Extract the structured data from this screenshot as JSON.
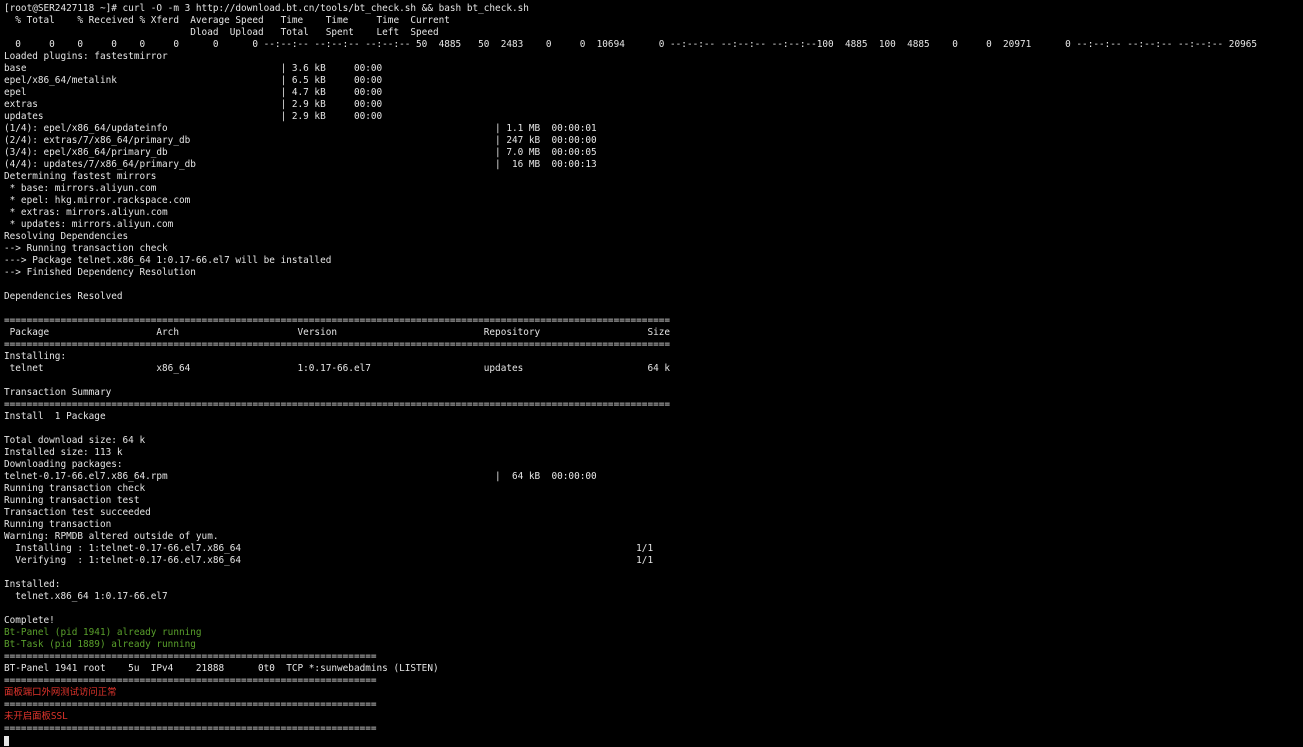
{
  "terminal": {
    "colors": {
      "background": "#000000",
      "foreground": "#e6e6e6",
      "green": "#5aa02c",
      "red": "#e0342c"
    },
    "lines": [
      {
        "text": "[root@SER2427118 ~]# curl -O -m 3 http://download.bt.cn/tools/bt_check.sh && bash bt_check.sh",
        "color": "default"
      },
      {
        "text": "  % Total    % Received % Xferd  Average Speed   Time    Time     Time  Current",
        "color": "default"
      },
      {
        "text": "                                 Dload  Upload   Total   Spent    Left  Speed",
        "color": "default"
      },
      {
        "text": "  0     0    0     0    0     0      0      0 --:--:-- --:--:-- --:--:-- 50  4885   50  2483    0     0  10694      0 --:--:-- --:--:-- --:--:--100  4885  100  4885    0     0  20971      0 --:--:-- --:--:-- --:--:-- 20965",
        "color": "default"
      },
      {
        "text": "Loaded plugins: fastestmirror",
        "color": "default"
      },
      {
        "text": "base                                             | 3.6 kB     00:00",
        "color": "default"
      },
      {
        "text": "epel/x86_64/metalink                             | 6.5 kB     00:00",
        "color": "default"
      },
      {
        "text": "epel                                             | 4.7 kB     00:00",
        "color": "default"
      },
      {
        "text": "extras                                           | 2.9 kB     00:00",
        "color": "default"
      },
      {
        "text": "updates                                          | 2.9 kB     00:00",
        "color": "default"
      },
      {
        "text": "(1/4): epel/x86_64/updateinfo                                                          | 1.1 MB  00:00:01",
        "color": "default"
      },
      {
        "text": "(2/4): extras/7/x86_64/primary_db                                                      | 247 kB  00:00:00",
        "color": "default"
      },
      {
        "text": "(3/4): epel/x86_64/primary_db                                                          | 7.0 MB  00:00:05",
        "color": "default"
      },
      {
        "text": "(4/4): updates/7/x86_64/primary_db                                                     |  16 MB  00:00:13",
        "color": "default"
      },
      {
        "text": "Determining fastest mirrors",
        "color": "default"
      },
      {
        "text": " * base: mirrors.aliyun.com",
        "color": "default"
      },
      {
        "text": " * epel: hkg.mirror.rackspace.com",
        "color": "default"
      },
      {
        "text": " * extras: mirrors.aliyun.com",
        "color": "default"
      },
      {
        "text": " * updates: mirrors.aliyun.com",
        "color": "default"
      },
      {
        "text": "Resolving Dependencies",
        "color": "default"
      },
      {
        "text": "--> Running transaction check",
        "color": "default"
      },
      {
        "text": "---> Package telnet.x86_64 1:0.17-66.el7 will be installed",
        "color": "default"
      },
      {
        "text": "--> Finished Dependency Resolution",
        "color": "default"
      },
      {
        "text": "",
        "color": "default"
      },
      {
        "text": "Dependencies Resolved",
        "color": "default"
      },
      {
        "text": "",
        "color": "default"
      },
      {
        "text": "======================================================================================================================",
        "color": "default"
      },
      {
        "text": " Package                   Arch                     Version                          Repository                   Size",
        "color": "default"
      },
      {
        "text": "======================================================================================================================",
        "color": "default"
      },
      {
        "text": "Installing:",
        "color": "default"
      },
      {
        "text": " telnet                    x86_64                   1:0.17-66.el7                    updates                      64 k",
        "color": "default"
      },
      {
        "text": "",
        "color": "default"
      },
      {
        "text": "Transaction Summary",
        "color": "default"
      },
      {
        "text": "======================================================================================================================",
        "color": "default"
      },
      {
        "text": "Install  1 Package",
        "color": "default"
      },
      {
        "text": "",
        "color": "default"
      },
      {
        "text": "Total download size: 64 k",
        "color": "default"
      },
      {
        "text": "Installed size: 113 k",
        "color": "default"
      },
      {
        "text": "Downloading packages:",
        "color": "default"
      },
      {
        "text": "telnet-0.17-66.el7.x86_64.rpm                                                          |  64 kB  00:00:00",
        "color": "default"
      },
      {
        "text": "Running transaction check",
        "color": "default"
      },
      {
        "text": "Running transaction test",
        "color": "default"
      },
      {
        "text": "Transaction test succeeded",
        "color": "default"
      },
      {
        "text": "Running transaction",
        "color": "default"
      },
      {
        "text": "Warning: RPMDB altered outside of yum.",
        "color": "default"
      },
      {
        "text": "  Installing : 1:telnet-0.17-66.el7.x86_64                                                                      1/1",
        "color": "default"
      },
      {
        "text": "  Verifying  : 1:telnet-0.17-66.el7.x86_64                                                                      1/1",
        "color": "default"
      },
      {
        "text": "",
        "color": "default"
      },
      {
        "text": "Installed:",
        "color": "default"
      },
      {
        "text": "  telnet.x86_64 1:0.17-66.el7",
        "color": "default"
      },
      {
        "text": "",
        "color": "default"
      },
      {
        "text": "Complete!",
        "color": "default"
      },
      {
        "text": "Bt-Panel (pid 1941) already running",
        "color": "green"
      },
      {
        "text": "Bt-Task (pid 1889) already running",
        "color": "green"
      },
      {
        "text": "==================================================================",
        "color": "default"
      },
      {
        "text": "BT-Panel 1941 root    5u  IPv4    21888      0t0  TCP *:sunwebadmins (LISTEN)",
        "color": "default"
      },
      {
        "text": "==================================================================",
        "color": "default"
      },
      {
        "text": "面板端口外网测试访问正常",
        "color": "red"
      },
      {
        "text": "==================================================================",
        "color": "default"
      },
      {
        "text": "未开启面板SSL",
        "color": "red"
      },
      {
        "text": "==================================================================",
        "color": "default"
      }
    ]
  }
}
